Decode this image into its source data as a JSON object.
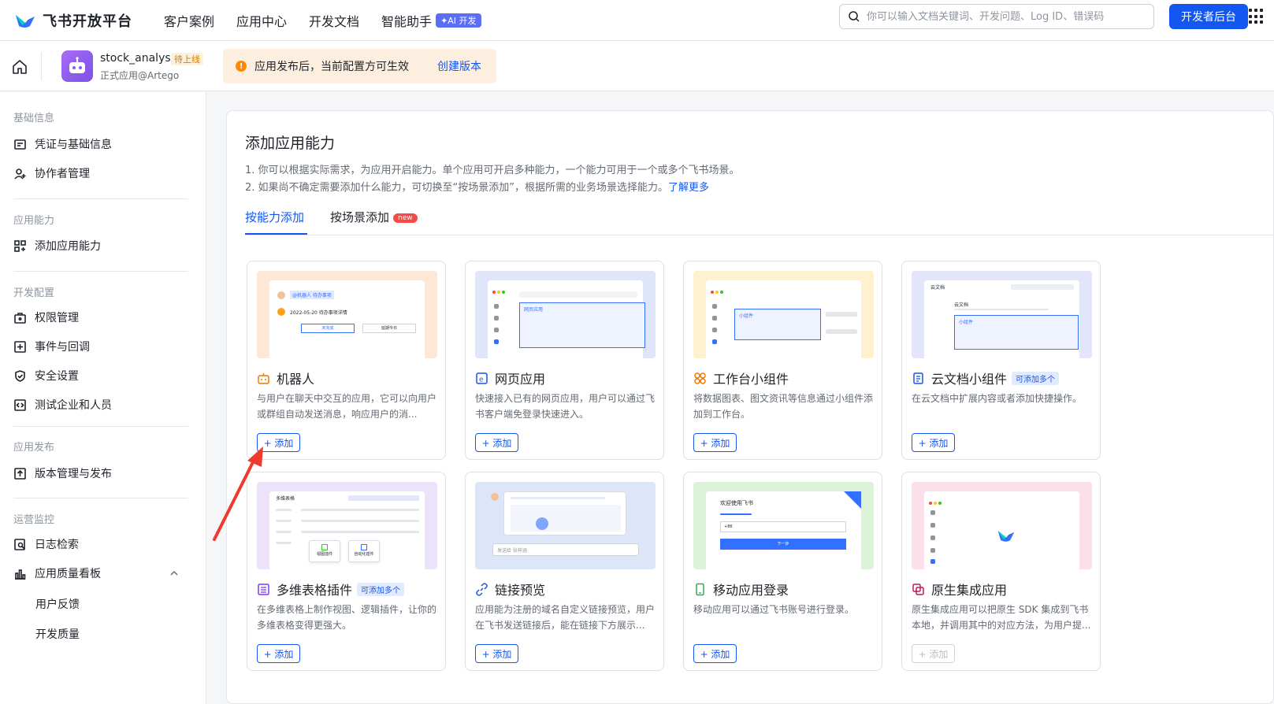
{
  "brand": {
    "name": "飞书开放平台"
  },
  "topnav": {
    "links": [
      "客户案例",
      "应用中心",
      "开发文档",
      "智能助手"
    ],
    "ai_badge": "✦AI 开发",
    "search_placeholder": "你可以输入文档关键词、开发问题、Log ID、错误码",
    "dev_button": "开发者后台"
  },
  "app": {
    "name": "stock_analyst",
    "status": "待上线",
    "owner": "正式应用@Artego"
  },
  "notice": {
    "text": "应用发布后，当前配置方可生效",
    "link": "创建版本"
  },
  "sidebar": {
    "groups": [
      {
        "title": "基础信息",
        "items": [
          "凭证与基础信息",
          "协作者管理"
        ]
      },
      {
        "title": "应用能力",
        "items": [
          "添加应用能力"
        ]
      },
      {
        "title": "开发配置",
        "items": [
          "权限管理",
          "事件与回调",
          "安全设置",
          "测试企业和人员"
        ]
      },
      {
        "title": "应用发布",
        "items": [
          "版本管理与发布"
        ]
      },
      {
        "title": "运营监控",
        "items": [
          "日志检索",
          "应用质量看板"
        ],
        "subitems": [
          "用户反馈",
          "开发质量"
        ]
      }
    ]
  },
  "main": {
    "title": "添加应用能力",
    "desc1": "1. 你可以根据实际需求，为应用开启能力。单个应用可开启多种能力，一个能力可用于一个或多个飞书场景。",
    "desc2": "2. 如果尚不确定需要添加什么能力，可切换至“按场景添加”，根据所需的业务场景选择能力。",
    "desc2_link": "了解更多",
    "tabs": [
      "按能力添加",
      "按场景添加"
    ],
    "new_badge": "new",
    "add_label": "+ 添加",
    "multi_label": "可添加多个",
    "cards": [
      {
        "title": "机器人",
        "desc": "与用户在聊天中交互的应用，它可以向用户或群组自动发送消息，响应用户的消...",
        "thumb_color": "#fde8d7",
        "icon": "robot-icon",
        "multi": false,
        "enabled": true,
        "thumb_text": [
          "@机器人 待办事项",
          "2022-05-20 待办事项详情",
          "未完成",
          "延期今日"
        ]
      },
      {
        "title": "网页应用",
        "desc": "快速接入已有的网页应用，用户可以通过飞书客户端免登录快速进入。",
        "thumb_color": "#dfe6f9",
        "icon": "web-app-icon",
        "multi": false,
        "enabled": true,
        "thumb_text": [
          "网页应用"
        ]
      },
      {
        "title": "工作台小组件",
        "desc": "将数据图表、图文资讯等信息通过小组件添加到工作台。",
        "thumb_color": "#fdf1cf",
        "icon": "widget-icon",
        "multi": false,
        "enabled": true,
        "thumb_text": [
          "小组件"
        ]
      },
      {
        "title": "云文档小组件",
        "desc": "在云文档中扩展内容或者添加快捷操作。",
        "thumb_color": "#e3e6fb",
        "icon": "doc-widget-icon",
        "multi": true,
        "enabled": true,
        "thumb_text": [
          "云文档",
          "云文档",
          "小组件"
        ]
      },
      {
        "title": "多维表格插件",
        "desc": "在多维表格上制作视图、逻辑插件，让你的多维表格变得更强大。",
        "thumb_color": "#ece3fb",
        "icon": "base-plugin-icon",
        "multi": true,
        "enabled": true,
        "thumb_text": [
          "多维表格",
          "视图插件",
          "自动化插件"
        ]
      },
      {
        "title": "链接预览",
        "desc": "应用能为注册的域名自定义链接预览，用户在飞书发送链接后，能在链接下方展示...",
        "thumb_color": "#dde6f8",
        "icon": "link-icon",
        "multi": false,
        "enabled": true,
        "thumb_text": [
          "发送给 张梓涵"
        ]
      },
      {
        "title": "移动应用登录",
        "desc": "移动应用可以通过飞书账号进行登录。",
        "thumb_color": "#dcf2d9",
        "icon": "mobile-login-icon",
        "multi": false,
        "enabled": true,
        "thumb_text": [
          "欢迎使用飞书",
          "下一步",
          "+86"
        ]
      },
      {
        "title": "原生集成应用",
        "desc": "原生集成应用可以把原生 SDK 集成到飞书本地，并调用其中的对应方法，为用户提...",
        "thumb_color": "#fbe0ec",
        "icon": "native-app-icon",
        "multi": false,
        "enabled": false,
        "thumb_text": []
      }
    ]
  },
  "colors": {
    "accent": "#1456f0",
    "annotation_arrow": "#f03a2e"
  }
}
